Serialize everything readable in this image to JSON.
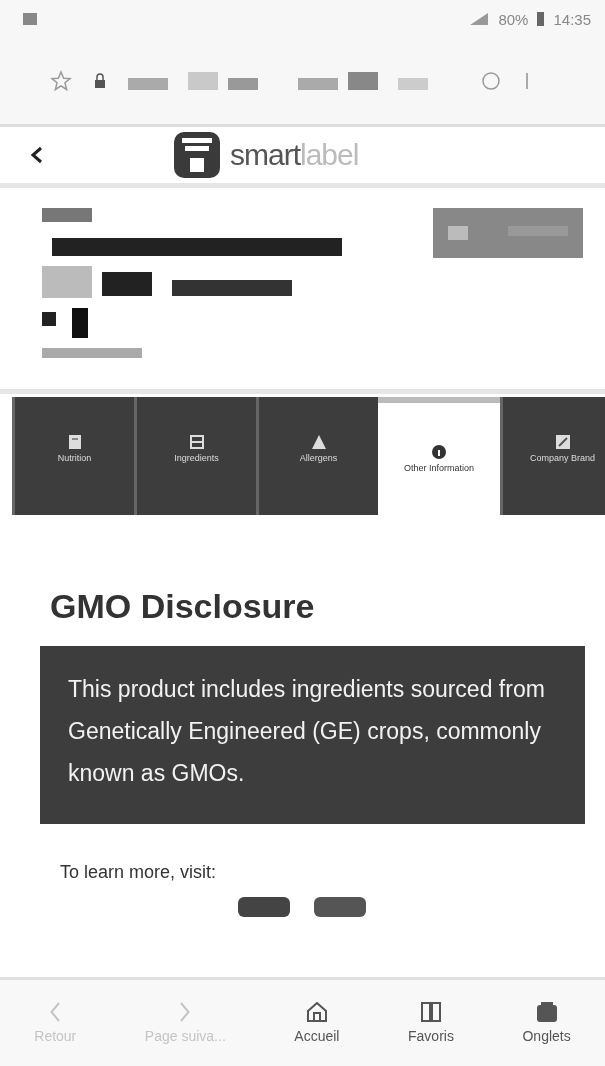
{
  "status_bar": {
    "signal_percent": "80%",
    "time": "14:35"
  },
  "header": {
    "logo": {
      "bold": "smart",
      "light": "label"
    }
  },
  "tabs": [
    {
      "label": "Nutrition",
      "selected": false
    },
    {
      "label": "Ingredients",
      "selected": false
    },
    {
      "label": "Allergens",
      "selected": false
    },
    {
      "label": "Other Information",
      "selected": true
    },
    {
      "label": "Company Brand",
      "selected": false
    }
  ],
  "section": {
    "title": "GMO Disclosure",
    "notice": "This product includes ingredients sourced from Genetically Engineered (GE) crops, commonly known as GMOs.",
    "learn_more": "To learn more, visit:"
  },
  "bottom_nav": [
    {
      "label": "Retour",
      "disabled": true
    },
    {
      "label": "Page suiva...",
      "disabled": true
    },
    {
      "label": "Accueil",
      "disabled": false
    },
    {
      "label": "Favoris",
      "disabled": false
    },
    {
      "label": "Onglets",
      "disabled": false
    }
  ]
}
